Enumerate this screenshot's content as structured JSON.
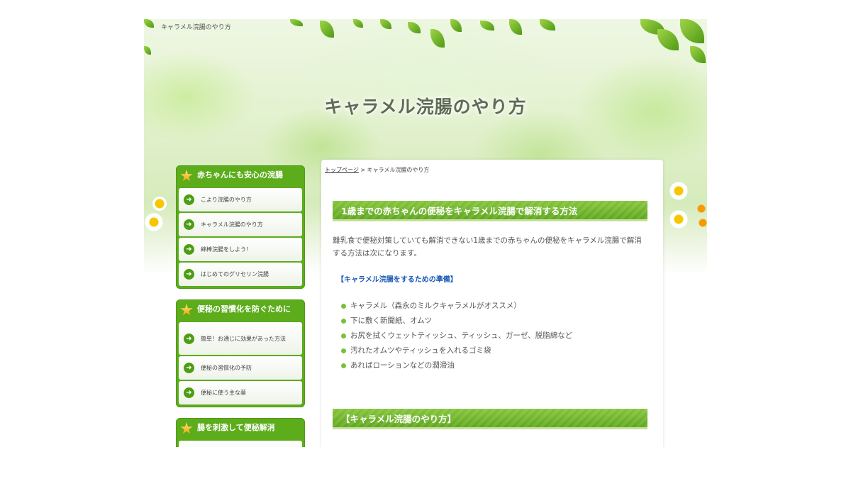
{
  "site": {
    "tagline": "キャラメル浣腸のやり方",
    "title": "キャラメル浣腸のやり方"
  },
  "sidebar": {
    "widgets": [
      {
        "title": "赤ちゃんにも安心の浣腸",
        "items": [
          {
            "label": "こより浣腸のやり方"
          },
          {
            "label": "キャラメル浣腸のやり方"
          },
          {
            "label": "綿棒浣腸をしよう！"
          },
          {
            "label": "はじめてのグリセリン浣腸"
          }
        ]
      },
      {
        "title": "便秘の習慣化を防ぐために",
        "items": [
          {
            "label": "簡単！お通じに効果があった方法"
          },
          {
            "label": "便秘の習慣化の予防"
          },
          {
            "label": "便秘に使う主な薬"
          }
        ]
      },
      {
        "title": "腸を刺激して便秘解消",
        "items": []
      }
    ]
  },
  "breadcrumb": {
    "home": "トップページ",
    "separator": " > ",
    "current": "キャラメル浣腸のやり方"
  },
  "main": {
    "heading1": "1歳までの赤ちゃんの便秘をキャラメル浣腸で解消する方法",
    "intro": "離乳食で便秘対策していても解消できない1歳までの赤ちゃんの便秘をキャラメル浣腸で解消する方法は次になります。",
    "prep_title": "【キャラメル浣腸をするための準備】",
    "prep_items": [
      "キャラメル（森永のミルクキャラメルがオススメ）",
      "下に敷く新聞紙、オムツ",
      "お尻を拭くウェットティッシュ、ティッシュ、ガーゼ、脱脂綿など",
      "汚れたオムツやティッシュを入れるゴミ袋",
      "あればローションなどの潤滑油"
    ],
    "heading2": "【キャラメル浣腸のやり方】"
  },
  "icons": {
    "widget_icon": "star-icon",
    "menu_icon": "arrow-right-circle-icon",
    "list_icon": "bullet-dot-icon"
  },
  "colors": {
    "accent_green": "#5cac1c",
    "link_blue": "#1a59b8"
  }
}
